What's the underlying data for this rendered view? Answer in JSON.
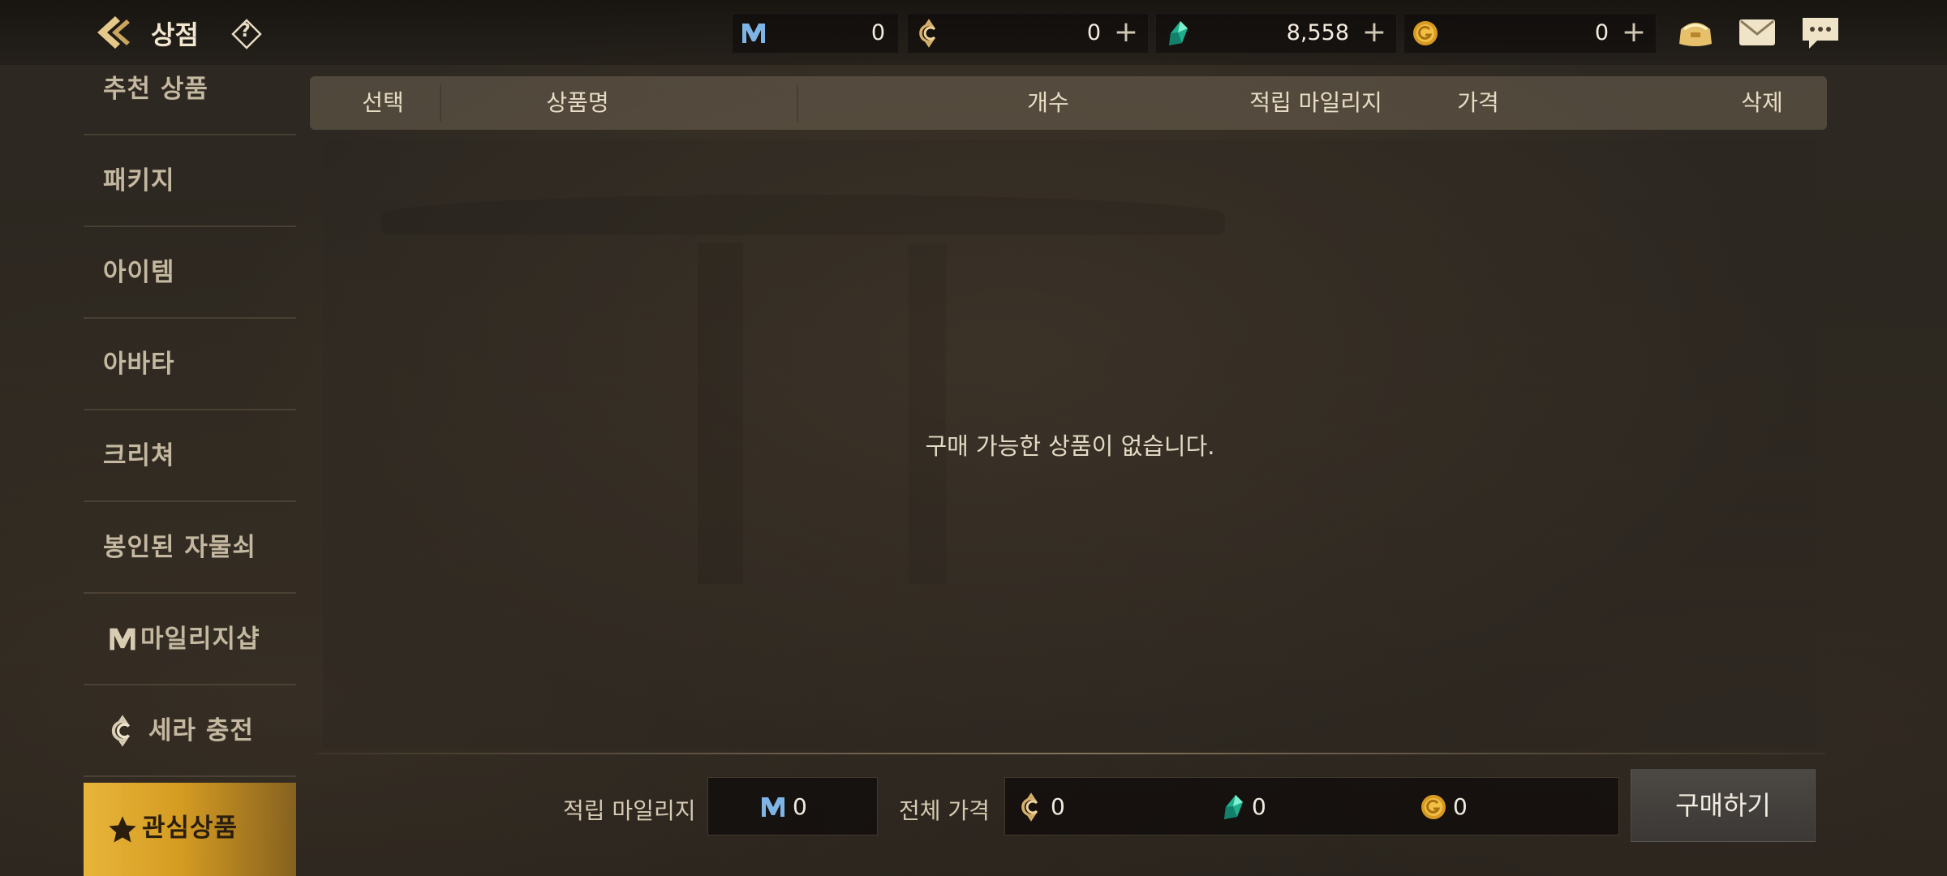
{
  "header": {
    "title": "상점",
    "help_symbol": "?"
  },
  "currencies": [
    {
      "name": "mileage",
      "icon": "mileage-icon",
      "value": "0",
      "has_plus": false
    },
    {
      "name": "sera",
      "icon": "sera-coin-icon",
      "value": "0",
      "has_plus": true
    },
    {
      "name": "gem",
      "icon": "green-gem-icon",
      "value": "8,558",
      "has_plus": true
    },
    {
      "name": "gold",
      "icon": "gold-coin-icon",
      "value": "0",
      "has_plus": true
    }
  ],
  "plus_symbol": "+",
  "top_icons": [
    "wallet-icon",
    "mail-icon",
    "chat-icon"
  ],
  "sidebar": {
    "items": [
      {
        "label": "추천 상품"
      },
      {
        "label": "패키지"
      },
      {
        "label": "아이템"
      },
      {
        "label": "아바타"
      },
      {
        "label": "크리쳐"
      },
      {
        "label": "봉인된 자물쇠"
      },
      {
        "label": "마일리지샵",
        "icon": "mileage-icon"
      },
      {
        "label": "세라 충전",
        "icon": "sera-coin-icon"
      },
      {
        "label": "관심상품",
        "icon": "star-icon",
        "active": true
      }
    ]
  },
  "table": {
    "columns": [
      "선택",
      "상품명",
      "개수",
      "적립 마일리지",
      "가격",
      "삭제"
    ],
    "empty_message": "구매 가능한 상품이 없습니다."
  },
  "footer": {
    "mileage_label": "적립 마일리지",
    "mileage_value": "0",
    "total_label": "전체 가격",
    "total_sera": "0",
    "total_gem": "0",
    "total_gold": "0",
    "buy_label": "구매하기"
  },
  "colors": {
    "accent_gold": "#e7b53a",
    "mileage_blue": "#7fb4e6",
    "gem_green": "#2ec6a0",
    "gold_coin": "#e0a52a"
  }
}
